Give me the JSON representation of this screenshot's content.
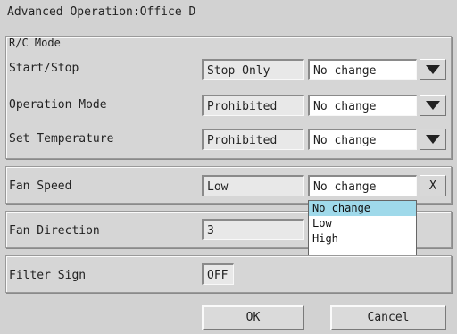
{
  "window": {
    "title": "Advanced Operation:Office D"
  },
  "rc_mode": {
    "section_label": "R/C Mode",
    "rows": [
      {
        "label": "Start/Stop",
        "status": "Stop Only",
        "selection": "No change"
      },
      {
        "label": "Operation Mode",
        "status": "Prohibited",
        "selection": "No change"
      },
      {
        "label": "Set Temperature",
        "status": "Prohibited",
        "selection": "No change"
      }
    ]
  },
  "fan_speed": {
    "label": "Fan Speed",
    "status": "Low",
    "selection": "No change",
    "close_label": "X"
  },
  "fan_speed_dropdown": {
    "options": [
      "No change",
      "Low",
      "High"
    ],
    "highlighted": "No change"
  },
  "fan_direction": {
    "label": "Fan Direction",
    "status": "3"
  },
  "filter_sign": {
    "label": "Filter Sign",
    "status": "OFF"
  },
  "buttons": {
    "ok": "OK",
    "cancel": "Cancel"
  }
}
